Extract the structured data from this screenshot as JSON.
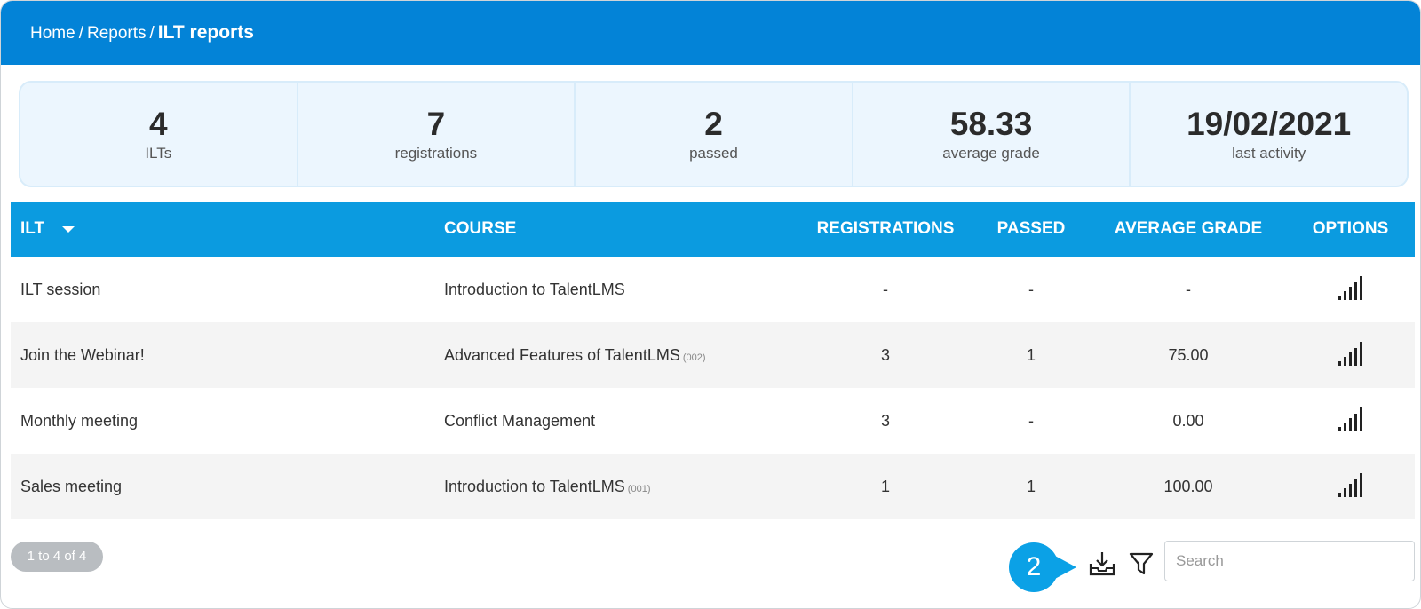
{
  "breadcrumb": {
    "home": "Home",
    "reports": "Reports",
    "current": "ILT reports",
    "separator": "/"
  },
  "stats": [
    {
      "value": "4",
      "label": "ILTs"
    },
    {
      "value": "7",
      "label": "registrations"
    },
    {
      "value": "2",
      "label": "passed"
    },
    {
      "value": "58.33",
      "label": "average grade"
    },
    {
      "value": "19/02/2021",
      "label": "last activity"
    }
  ],
  "table": {
    "columns": {
      "ilt": "ILT",
      "course": "COURSE",
      "registrations": "REGISTRATIONS",
      "passed": "PASSED",
      "average_grade": "AVERAGE GRADE",
      "options": "OPTIONS"
    },
    "rows": [
      {
        "ilt": "ILT session",
        "course": "Introduction to TalentLMS",
        "code": "",
        "registrations": "-",
        "passed": "-",
        "average_grade": "-"
      },
      {
        "ilt": "Join the Webinar!",
        "course": "Advanced Features of TalentLMS",
        "code": "(002)",
        "registrations": "3",
        "passed": "1",
        "average_grade": "75.00"
      },
      {
        "ilt": "Monthly meeting",
        "course": "Conflict Management",
        "code": "",
        "registrations": "3",
        "passed": "-",
        "average_grade": "0.00"
      },
      {
        "ilt": "Sales meeting",
        "course": "Introduction to TalentLMS",
        "code": "(001)",
        "registrations": "1",
        "passed": "1",
        "average_grade": "100.00"
      }
    ]
  },
  "footer": {
    "pagination": "1 to 4 of 4",
    "step_marker": "2",
    "search_placeholder": "Search"
  },
  "colors": {
    "topbar": "#0383d7",
    "table_header": "#0b9be0",
    "stats_bg": "#ecf6fe",
    "step_marker": "#0ba1e6"
  },
  "icons": {
    "sort": "caret-down-icon",
    "options": "reports-bars-icon",
    "export": "download-tray-icon",
    "filter": "filter-funnel-icon"
  }
}
